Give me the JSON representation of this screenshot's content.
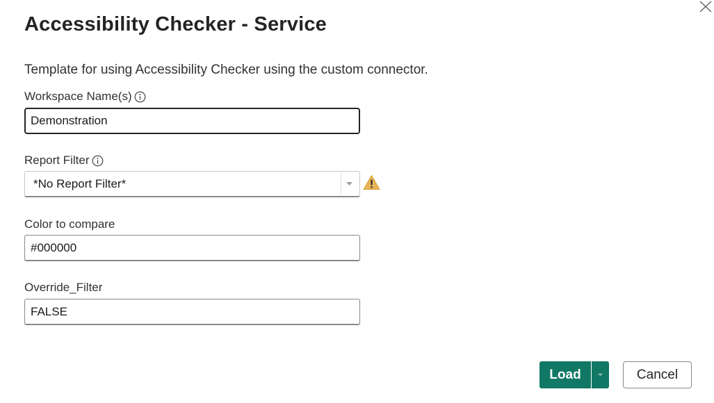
{
  "dialog": {
    "title": "Accessibility Checker - Service",
    "description": "Template for using Accessibility Checker using the custom connector.",
    "close_icon": "close-icon"
  },
  "fields": {
    "workspace": {
      "label": "Workspace Name(s)",
      "value": "Demonstration",
      "info_icon": "info-icon"
    },
    "report_filter": {
      "label": "Report Filter",
      "selected": "*No Report Filter*",
      "info_icon": "info-icon",
      "warning_icon": "warning-icon"
    },
    "color": {
      "label": "Color to compare",
      "value": "#000000"
    },
    "override": {
      "label": "Override_Filter",
      "value": "FALSE"
    }
  },
  "buttons": {
    "load_label": "Load",
    "cancel_label": "Cancel"
  },
  "colors": {
    "accent": "#117865",
    "warning": "#e3a83b",
    "text": "#252423"
  }
}
